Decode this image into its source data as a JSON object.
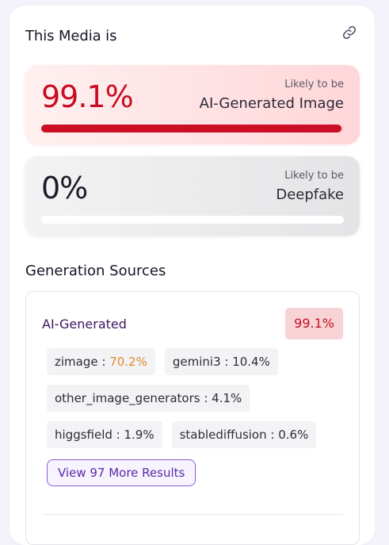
{
  "header": {
    "title": "This Media is"
  },
  "results": [
    {
      "id": "ai",
      "percent": "99.1%",
      "likely_text": "Likely to be",
      "label": "AI-Generated Image",
      "bar_fill_fraction": 0.991,
      "color": "#c80b21"
    },
    {
      "id": "deepfake",
      "percent": "0%",
      "likely_text": "Likely to be",
      "label": "Deepfake",
      "bar_fill_fraction": 0.0,
      "color": "#1c1c2a"
    }
  ],
  "sources": {
    "section_title": "Generation Sources",
    "category": "AI-Generated",
    "category_percent": "99.1%",
    "items": [
      {
        "name": "zimage",
        "value": "70.2%",
        "highlight": true
      },
      {
        "name": "gemini3",
        "value": "10.4%",
        "highlight": false
      },
      {
        "name": "other_image_generators",
        "value": "4.1%",
        "highlight": false
      },
      {
        "name": "higgsfield",
        "value": "1.9%",
        "highlight": false
      },
      {
        "name": "stablediffusion",
        "value": "0.6%",
        "highlight": false
      }
    ],
    "more_button_label": "View 97 More Results"
  },
  "icons": {
    "share": "link-icon"
  },
  "colors": {
    "accent_red": "#c80b21",
    "accent_purple": "#5b2aa8",
    "highlight_orange": "#e08a2b"
  }
}
